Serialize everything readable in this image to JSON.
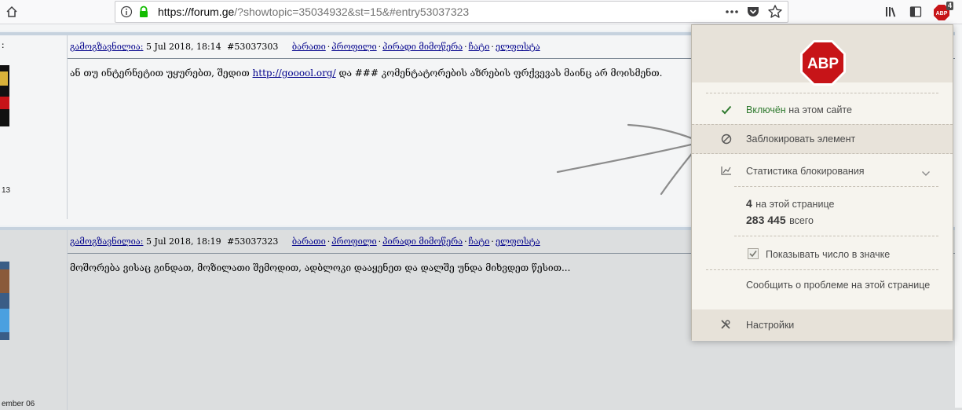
{
  "browser": {
    "url_host": "https://forum.ge",
    "url_rest": "/?showtopic=35034932&st=15&#entry53037323",
    "abp_badge_count": "4"
  },
  "posts": [
    {
      "poster_label": "გამოგზავნილია:",
      "date": "5 Jul 2018, 18:14",
      "entry": "#53037303",
      "links": [
        "ბარათი",
        "პროფილი",
        "პირადი მიმოწერა",
        "ჩატი",
        "ელფოსტა"
      ],
      "text_before": "ან თუ ინტერნეტით უყურებთ, შედით",
      "link_text": "http://gooool.org/",
      "text_after": "და ### კომენტატორების აზრების ფრქვევას მაინც არ მოისმენთ.",
      "side_label": ":",
      "side_count": "13"
    },
    {
      "poster_label": "გამოგზავნილია:",
      "date": "5 Jul 2018, 18:19",
      "entry": "#53037323",
      "links": [
        "ბარათი",
        "პროფილი",
        "პირადი მიმოწერა",
        "ჩატი",
        "ელფოსტა"
      ],
      "text": "მოშორება ვისაც გინდათ, მოზილათი შემოდით, ადბლოკი დააყენეთ და დალშე უნდა მიხვდეთ წესით...",
      "side_label": "ember 06"
    }
  ],
  "abp": {
    "logo_text": "ABP",
    "status_on": "Включён",
    "status_rest": "на этом сайте",
    "block_element": "Заблокировать элемент",
    "stats_title": "Статистика блокирования",
    "page_count": "4",
    "page_count_label": "на этой странице",
    "total_count": "283 445",
    "total_count_label": "всего",
    "show_in_icon": "Показывать число в значке",
    "report_issue": "Сообщить о проблеме на этой странице",
    "settings": "Настройки"
  },
  "colors": {
    "abp_red": "#c71418",
    "status_green": "#2f7a2f",
    "link_blue": "#00008b",
    "lock_green": "#12bc00"
  },
  "icons": [
    "home-icon",
    "info-icon",
    "lock-icon",
    "more-icon",
    "pocket-icon",
    "star-icon",
    "library-icon",
    "sidebar-icon",
    "abp-icon",
    "check-icon",
    "block-icon",
    "stats-icon",
    "chevron-down-icon",
    "settings-icon"
  ]
}
